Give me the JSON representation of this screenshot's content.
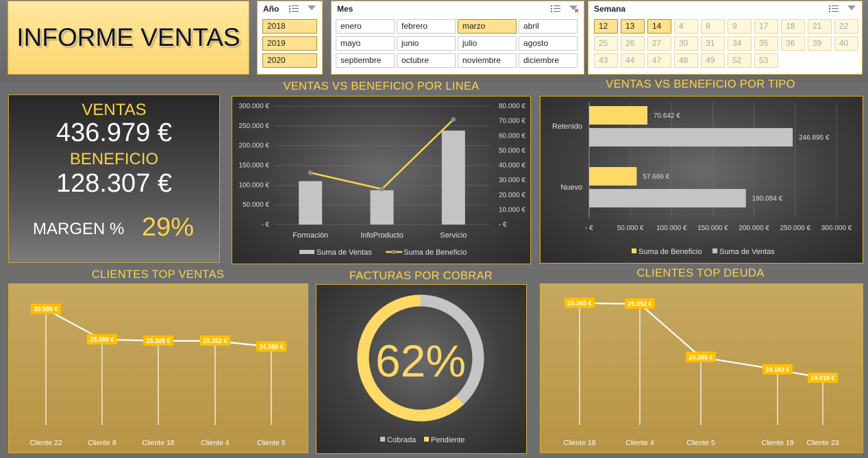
{
  "title": "INFORME VENTAS",
  "slicers": {
    "year": {
      "header": "Año",
      "items": [
        "2018",
        "2019",
        "2020"
      ]
    },
    "month": {
      "header": "Mes",
      "items": [
        "enero",
        "febrero",
        "marzo",
        "abril",
        "mayo",
        "junio",
        "julio",
        "agosto",
        "septiembre",
        "octubre",
        "noviembre",
        "diciembre"
      ],
      "selected": "marzo"
    },
    "week": {
      "header": "Semana",
      "items": [
        "12",
        "13",
        "14",
        "4",
        "8",
        "9",
        "17",
        "18",
        "21",
        "22",
        "25",
        "26",
        "27",
        "30",
        "31",
        "34",
        "35",
        "36",
        "39",
        "40",
        "43",
        "44",
        "47",
        "48",
        "49",
        "52",
        "53"
      ],
      "selected": [
        "12",
        "13",
        "14"
      ]
    }
  },
  "kpi": {
    "ventas_label": "VENTAS",
    "ventas_value": "436.979 €",
    "beneficio_label": "BENEFICIO",
    "beneficio_value": "128.307 €",
    "margen_label": "MARGEN %",
    "margen_value": "29%"
  },
  "colors": {
    "accent": "#ffd24a",
    "bar_grey": "#c4c4c4",
    "panel_border": "#d7ad35"
  },
  "sections": {
    "linea": "VENTAS VS BENEFICIO POR LINEA",
    "tipo": "VENTAS VS BENEFICIO POR TIPO",
    "top_ventas": "CLIENTES TOP VENTAS",
    "facturas": "FACTURAS POR COBRAR",
    "top_deuda": "CLIENTES TOP DEUDA"
  },
  "chart_data": [
    {
      "type": "bar",
      "title": "VENTAS VS BENEFICIO POR LINEA",
      "categories": [
        "Formación",
        "InfoProducto",
        "Servicio"
      ],
      "series": [
        {
          "name": "Suma de Ventas",
          "type": "bar",
          "axis": "left",
          "values": [
            110000,
            87000,
            238000
          ]
        },
        {
          "name": "Suma de Beneficio",
          "type": "line",
          "axis": "right",
          "values": [
            35000,
            24000,
            71000
          ]
        }
      ],
      "left_ticks": [
        "300.000 €",
        "250.000 €",
        "200.000 €",
        "150.000 €",
        "100.000 €",
        "50.000 €",
        "-  €"
      ],
      "right_ticks": [
        "80.000 €",
        "70.000 €",
        "60.000 €",
        "50.000 €",
        "40.000 €",
        "30.000 €",
        "20.000 €",
        "10.000 €",
        "-  €"
      ],
      "ylim_left": [
        0,
        300000
      ],
      "ylim_right": [
        0,
        80000
      ],
      "legend": [
        "Suma de Ventas",
        "Suma de Beneficio"
      ],
      "legend_position": "bottom"
    },
    {
      "type": "bar",
      "orientation": "horizontal",
      "title": "VENTAS VS BENEFICIO POR TIPO",
      "categories": [
        "Retenido",
        "Nuevo"
      ],
      "series": [
        {
          "name": "Suma de Beneficio",
          "values": [
            70642,
            57666
          ],
          "labels": [
            "70.642 €",
            "57.666 €"
          ]
        },
        {
          "name": "Suma de Ventas",
          "values": [
            246895,
            190084
          ],
          "labels": [
            "246.895 €",
            "190.084 €"
          ]
        }
      ],
      "x_ticks": [
        "-  €",
        "50.000 €",
        "100.000 €",
        "150.000 €",
        "200.000 €",
        "250.000 €",
        "300.000 €"
      ],
      "xlim": [
        0,
        300000
      ],
      "legend": [
        "Suma de Beneficio",
        "Suma de Ventas"
      ],
      "legend_position": "bottom"
    },
    {
      "type": "line",
      "title": "CLIENTES TOP VENTAS",
      "categories": [
        "Cliente 22",
        "Cliente 8",
        "Cliente 18",
        "Cliente 4",
        "Cliente 5"
      ],
      "values": [
        30585,
        25588,
        25365,
        25352,
        24386
      ],
      "labels": [
        "30.585 €",
        "25.588 €",
        "25.365 €",
        "25.352 €",
        "24.386 €"
      ]
    },
    {
      "type": "pie",
      "subtype": "donut",
      "title": "FACTURAS POR COBRAR",
      "center_label": "62%",
      "slices": [
        {
          "name": "Cobrada",
          "value": 38
        },
        {
          "name": "Pendiente",
          "value": 62
        }
      ],
      "legend": [
        "Cobrada",
        "Pendiente"
      ]
    },
    {
      "type": "line",
      "title": "CLIENTES TOP DEUDA",
      "categories": [
        "Cliente 18",
        "Cliente 4",
        "Cliente 5",
        "Cliente 19",
        "Cliente 23"
      ],
      "values": [
        25365,
        25352,
        24386,
        24163,
        24010
      ],
      "labels": [
        "25.365 €",
        "25.352 €",
        "24.386 €",
        "24.163 €",
        "24.010 €"
      ]
    }
  ]
}
